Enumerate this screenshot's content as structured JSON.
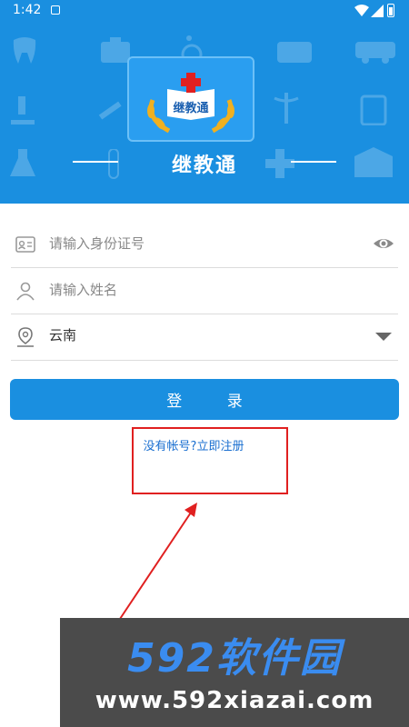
{
  "status_bar": {
    "time": "1:42"
  },
  "header": {
    "app_title": "继教通",
    "logo_text": "继教通"
  },
  "form": {
    "id_placeholder": "请输入身份证号",
    "name_placeholder": "请输入姓名",
    "region_value": "云南"
  },
  "login_button_label": "登 录",
  "register_link": "没有帐号?立即注册",
  "watermark": {
    "brand": "592软件园",
    "url": "www.592xiazai.com"
  },
  "colors": {
    "primary": "#1a8fe0",
    "annotation": "#e02020",
    "link": "#1a6fd0"
  },
  "icons": [
    "wifi-icon",
    "signal-icon",
    "battery-icon",
    "id-card-icon",
    "person-icon",
    "location-icon",
    "eye-icon",
    "dropdown-arrow-icon"
  ]
}
